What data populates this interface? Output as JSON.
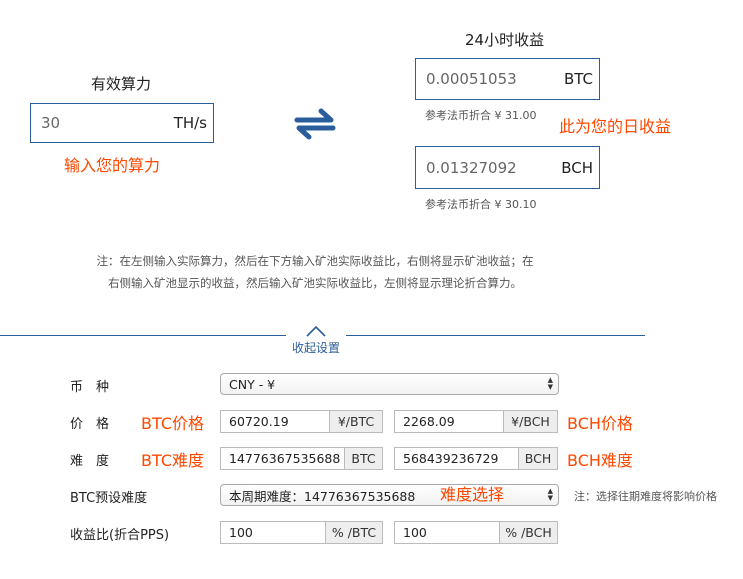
{
  "hashrate": {
    "title": "有效算力",
    "value": "30",
    "unit": "TH/s",
    "hint": "输入您的算力"
  },
  "income": {
    "title": "24小时收益",
    "btc": {
      "value": "0.00051053",
      "unit": "BTC",
      "ref": "参考法币折合 ¥ 31.00"
    },
    "bch": {
      "value": "0.01327092",
      "unit": "BCH",
      "ref": "参考法币折合 ¥ 30.10"
    },
    "hint": "此为您的日收益"
  },
  "swap_icon": "swap-arrows-icon",
  "note": "注：在左侧输入实际算力，然后在下方输入矿池实际收益比，右侧将显示矿池收益；在右侧输入矿池显示的收益，然后输入矿池实际收益比，左侧将显示理论折合算力。",
  "toggle": {
    "label": "收起设置",
    "icon": "chevron-up-icon"
  },
  "settings": {
    "currency": {
      "label": "币　种",
      "selected": "CNY - ¥"
    },
    "price": {
      "label": "价　格",
      "btc_value": "60720.19",
      "btc_unit": "¥/BTC",
      "bch_value": "2268.09",
      "bch_unit": "¥/BCH",
      "btc_annotation": "BTC价格",
      "bch_annotation": "BCH价格"
    },
    "difficulty": {
      "label": "难　度",
      "btc_value": "14776367535688",
      "btc_unit": "BTC",
      "bch_value": "568439236729",
      "bch_unit": "BCH",
      "btc_annotation": "BTC难度",
      "bch_annotation": "BCH难度"
    },
    "btc_preset": {
      "label": "BTC预设难度",
      "selected": "本周期难度：14776367535688",
      "annotation": "难度选择",
      "note": "注：选择往期难度将影响价格"
    },
    "ratio": {
      "label": "收益比(折合PPS)",
      "btc_value": "100",
      "btc_unit": "% /BTC",
      "bch_value": "100",
      "bch_unit": "% /BCH"
    }
  },
  "colors": {
    "accent": "#2a5d9c",
    "annotation": "#ff4800"
  }
}
